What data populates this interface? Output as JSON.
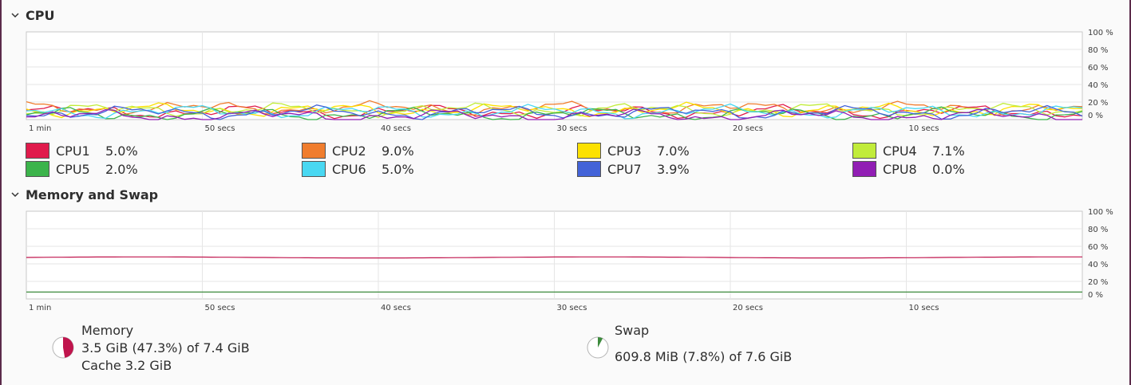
{
  "cpu_section": {
    "title": "CPU",
    "y_ticks": [
      "100 %",
      "80 %",
      "60 %",
      "40 %",
      "20 %",
      "0 %"
    ],
    "x_ticks": [
      "1 min",
      "50 secs",
      "40 secs",
      "30 secs",
      "20 secs",
      "10 secs"
    ],
    "cpus": [
      {
        "label": "CPU1",
        "value": "5.0%",
        "color": "#e01b4c"
      },
      {
        "label": "CPU2",
        "value": "9.0%",
        "color": "#f07d2e"
      },
      {
        "label": "CPU3",
        "value": "7.0%",
        "color": "#fce100"
      },
      {
        "label": "CPU4",
        "value": "7.1%",
        "color": "#c1ec3a"
      },
      {
        "label": "CPU5",
        "value": "2.0%",
        "color": "#3cb44b"
      },
      {
        "label": "CPU6",
        "value": "5.0%",
        "color": "#49d8f2"
      },
      {
        "label": "CPU7",
        "value": "3.9%",
        "color": "#4363d8"
      },
      {
        "label": "CPU8",
        "value": "0.0%",
        "color": "#911eb4"
      }
    ]
  },
  "memory_section": {
    "title": "Memory and Swap",
    "y_ticks": [
      "100 %",
      "80 %",
      "60 %",
      "40 %",
      "20 %",
      "0 %"
    ],
    "x_ticks": [
      "1 min",
      "50 secs",
      "40 secs",
      "30 secs",
      "20 secs",
      "10 secs"
    ],
    "memory": {
      "label": "Memory",
      "usage": "3.5 GiB (47.3%) of 7.4 GiB",
      "cache": "Cache 3.2 GiB",
      "percent": 47.3,
      "color": "#c0154d"
    },
    "swap": {
      "label": "Swap",
      "usage": "609.8 MiB (7.8%) of 7.6 GiB",
      "percent": 7.8,
      "color": "#3d8b3d"
    }
  }
}
